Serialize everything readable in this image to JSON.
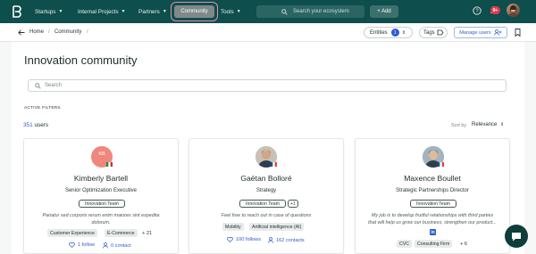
{
  "nav": {
    "items": [
      {
        "label": "Startups"
      },
      {
        "label": "Internal Projects"
      },
      {
        "label": "Partners"
      },
      {
        "label": "Community"
      },
      {
        "label": "Tools"
      }
    ],
    "search_placeholder": "Search your ecosystem",
    "add_label": "+ Add",
    "notification_count": "9+",
    "accent": "#0e4e4c"
  },
  "breadcrumb": {
    "items": [
      "Home",
      "Community"
    ],
    "separator": "/"
  },
  "toolbar": {
    "entities_label": "Entities",
    "entities_count": "1",
    "tags_label": "Tags",
    "manage_users_label": "Manage users"
  },
  "page": {
    "title": "Innovation community",
    "search_placeholder": "Search",
    "active_filters_label": "ACTIVE FILTERS",
    "user_count": "351",
    "user_count_suffix": "users",
    "sort_label": "Sort by",
    "sort_value": "Relevance"
  },
  "cards": [
    {
      "initials": "KB",
      "name": "Kimberly Bartell",
      "role": "Senior Optimization Executive",
      "team": "Innovation Team",
      "bio_line1": "Pariatur sed corporis rerum enim maiores sint expedita",
      "bio_line2": "dolorum.",
      "tags": [
        "Customer Experience",
        "E-Commerce"
      ],
      "more": "+ 21",
      "follows": "1 follow",
      "contacts": "0 contact"
    },
    {
      "name": "Gaëtan Bolloré",
      "role": "Strategy",
      "team": "Innovation Team",
      "team_more": "+1",
      "bio_line1": "Feel free to reach out in case of questions",
      "tags": [
        "Mobility",
        "Artificial intelligence (AI)"
      ],
      "follows": "100 follows",
      "contacts": "162 contacts"
    },
    {
      "name": "Maxence Boullet",
      "role": "Strategic Partnerships Director",
      "team": "Innovation Team",
      "bio_line1": "My job is to develop fruitful relationships with third parties",
      "bio_line2": "that will help us grow our business, strengthen our product...",
      "linkedin": "in",
      "tags": [
        "CVC",
        "Consulting Firm"
      ],
      "more": "+ 6"
    }
  ]
}
